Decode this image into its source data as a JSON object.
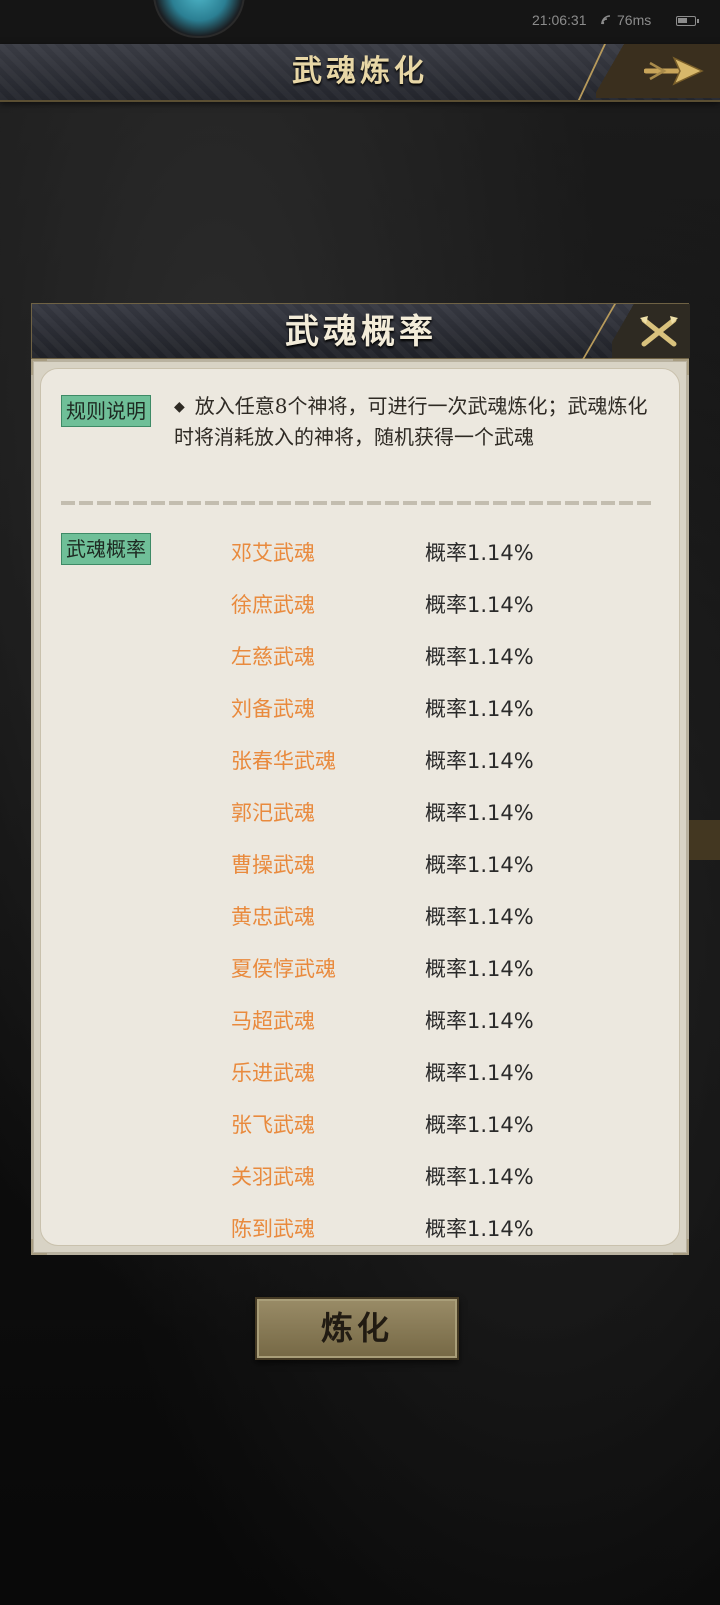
{
  "status_bar": {
    "time": "21:06:31",
    "ping": "76ms"
  },
  "header": {
    "title": "武魂炼化"
  },
  "dialog": {
    "title": "武魂概率",
    "rules_tag": "规则说明",
    "rules_text": "放入任意8个神将，可进行一次武魂炼化；武魂炼化时将消耗放入的神将，随机获得一个武魂",
    "prob_tag": "武魂概率",
    "items": [
      {
        "name": "邓艾武魂",
        "prob": "概率1.14%"
      },
      {
        "name": "徐庶武魂",
        "prob": "概率1.14%"
      },
      {
        "name": "左慈武魂",
        "prob": "概率1.14%"
      },
      {
        "name": "刘备武魂",
        "prob": "概率1.14%"
      },
      {
        "name": "张春华武魂",
        "prob": "概率1.14%"
      },
      {
        "name": "郭汜武魂",
        "prob": "概率1.14%"
      },
      {
        "name": "曹操武魂",
        "prob": "概率1.14%"
      },
      {
        "name": "黄忠武魂",
        "prob": "概率1.14%"
      },
      {
        "name": "夏侯惇武魂",
        "prob": "概率1.14%"
      },
      {
        "name": "马超武魂",
        "prob": "概率1.14%"
      },
      {
        "name": "乐进武魂",
        "prob": "概率1.14%"
      },
      {
        "name": "张飞武魂",
        "prob": "概率1.14%"
      },
      {
        "name": "关羽武魂",
        "prob": "概率1.14%"
      },
      {
        "name": "陈到武魂",
        "prob": "概率1.14%"
      }
    ]
  },
  "refine_button": {
    "label": "炼化"
  },
  "colors": {
    "item_name": "#e98a3d",
    "tag_bg": "#6fbf98",
    "panel_bg": "#ece8df",
    "gold": "#e8d7a6"
  },
  "icons": {
    "back": "arrow-right-icon",
    "close": "close-x-icon",
    "wifi": "wifi-icon",
    "battery": "battery-icon"
  }
}
